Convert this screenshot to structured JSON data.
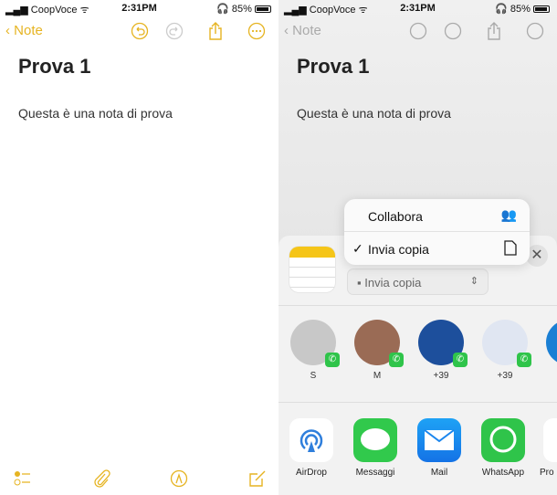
{
  "status": {
    "carrier": "CoopVoce",
    "time": "2:31PM",
    "battery": "85%"
  },
  "nav": {
    "back_label": "Note"
  },
  "note": {
    "title": "Prova 1",
    "body": "Questa è una nota di prova"
  },
  "share_menu": {
    "items": [
      {
        "label": "Collabora",
        "icon": "people-icon",
        "checked": false
      },
      {
        "label": "Invia copia",
        "icon": "document-icon",
        "checked": true
      }
    ],
    "check": "✓"
  },
  "share_sheet": {
    "selector_label": "Invia copia",
    "close": "✕",
    "contacts": [
      {
        "name": "S",
        "color": "#c8c8c8"
      },
      {
        "name": "M",
        "color": "#9a6b55"
      },
      {
        "name": "+39",
        "color": "#1d4f9c"
      },
      {
        "name": "+39",
        "color": "#e0e6f2"
      },
      {
        "name": "+",
        "color": "#1a7fd4"
      }
    ],
    "apps": [
      {
        "label": "AirDrop"
      },
      {
        "label": "Messaggi"
      },
      {
        "label": "Mail"
      },
      {
        "label": "WhatsApp"
      },
      {
        "label": "Pro"
      }
    ]
  },
  "colors": {
    "accent": "#e6b422",
    "whatsapp": "#2fc44a"
  }
}
